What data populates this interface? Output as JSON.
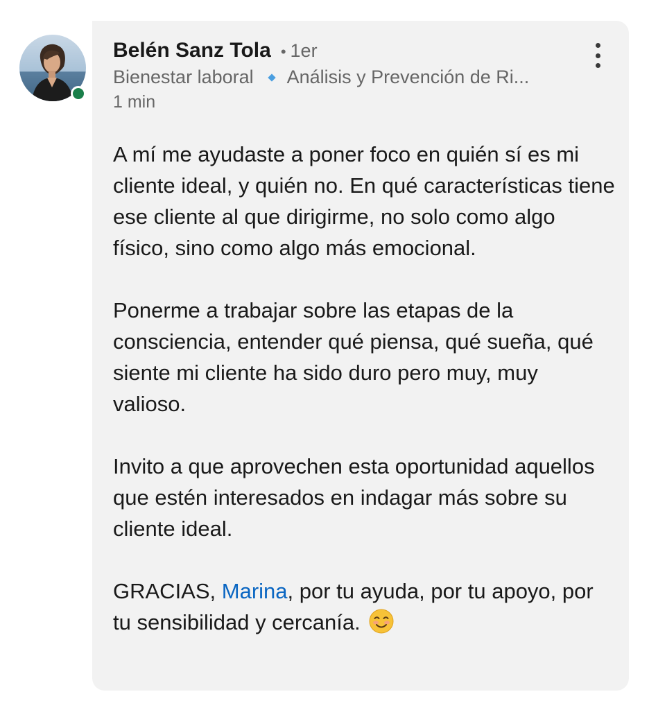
{
  "comment": {
    "author": "Belén Sanz Tola",
    "separator": "•",
    "degree": "1er",
    "headline_part1": "Bienestar laboral",
    "headline_part2": "Análisis y Prevención de Ri...",
    "time": "1 min",
    "paragraphs": [
      "A mí me ayudaste a poner foco en quién sí es mi cliente ideal, y quién no. En qué características tiene ese cliente al que dirigirme, no solo como algo físico, sino como algo más emocional.",
      "Ponerme a trabajar sobre las etapas de la consciencia, entender qué piensa, qué sueña, qué siente mi cliente ha sido duro pero muy, muy valioso.",
      "Invito a que aprovechen esta oportunidad aquellos que estén interesados en indagar más sobre su cliente ideal."
    ],
    "closing": {
      "prefix": "GRACIAS, ",
      "mention": "Marina",
      "suffix": ", por tu ayuda, por tu apoyo, por tu sensibilidad y cercanía. "
    },
    "icons": {
      "presence": "online-status-icon",
      "menu": "more-options-icon",
      "emoji": "smiling-face-icon"
    },
    "colors": {
      "bubble": "#f2f2f2",
      "mention": "#0a66c2",
      "presence": "#1a7f4a",
      "diamond": "#4a9ee0"
    }
  }
}
